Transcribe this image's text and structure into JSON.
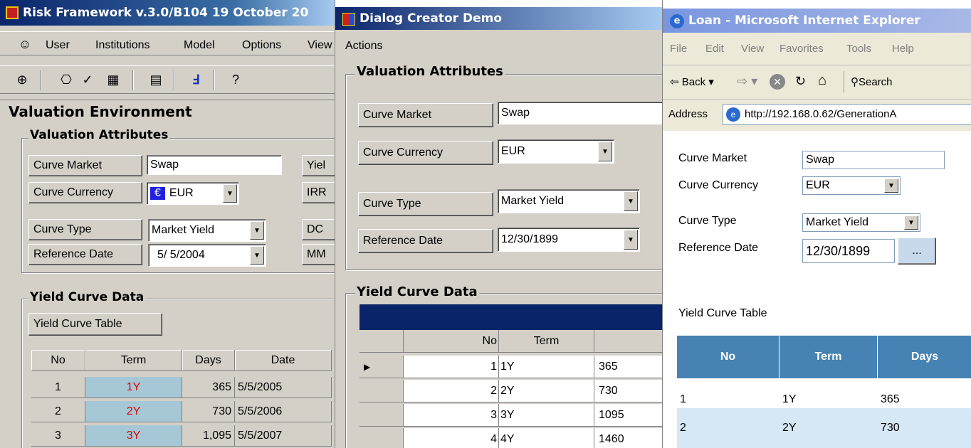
{
  "panel1": {
    "title": "Risk Framework v.3.0/B104 19 October 20",
    "menu": [
      "User",
      "Institutions",
      "Model",
      "Options",
      "View"
    ],
    "section_title": "Valuation Environment",
    "valuation_group": "Valuation Attributes",
    "curve_market_btn": "Curve Market",
    "curve_market_val": "Swap",
    "curve_currency_btn": "Curve Currency",
    "currency_symbol": "€",
    "curve_currency_val": "EUR",
    "curve_type_btn": "Curve Type",
    "curve_type_val": "Market Yield",
    "ref_date_btn": "Reference Date",
    "ref_date_val": "5/ 5/2004",
    "right_labels": [
      "Yiel",
      "IRR",
      "DC",
      "MM"
    ],
    "yield_group": "Yield Curve Data",
    "yield_table_btn": "Yield Curve Table",
    "grid_headers": [
      "No",
      "Term",
      "Days",
      "Date"
    ],
    "grid_rows": [
      {
        "no": "1",
        "term": "1Y",
        "days": "365",
        "date": "5/5/2005"
      },
      {
        "no": "2",
        "term": "2Y",
        "days": "730",
        "date": "5/5/2006"
      },
      {
        "no": "3",
        "term": "3Y",
        "days": "1,095",
        "date": "5/5/2007"
      }
    ]
  },
  "panel2": {
    "title": "Dialog Creator Demo",
    "menu": "Actions",
    "valuation_group": "Valuation Attributes",
    "curve_market_btn": "Curve Market",
    "curve_market_val": "Swap",
    "curve_currency_btn": "Curve Currency",
    "curve_currency_val": "EUR",
    "curve_type_btn": "Curve Type",
    "curve_type_val": "Market Yield",
    "ref_date_btn": "Reference Date",
    "ref_date_val": "12/30/1899",
    "yield_group": "Yield Curve Data",
    "grid_headers": [
      "No",
      "Term"
    ],
    "grid_rows": [
      {
        "no": "1",
        "term": "1Y",
        "days": "365"
      },
      {
        "no": "2",
        "term": "2Y",
        "days": "730"
      },
      {
        "no": "3",
        "term": "3Y",
        "days": "1095"
      },
      {
        "no": "4",
        "term": "4Y",
        "days": "1460"
      }
    ]
  },
  "panel3": {
    "title": "Loan - Microsoft Internet Explorer",
    "menu": [
      "File",
      "Edit",
      "View",
      "Favorites",
      "Tools",
      "Help"
    ],
    "back_label": "Back",
    "search_label": "Search",
    "address_label": "Address",
    "address_value": "http://192.168.0.62/GenerationA",
    "curve_market_label": "Curve Market",
    "curve_market_val": "Swap",
    "curve_currency_label": "Curve Currency",
    "curve_currency_val": "EUR",
    "curve_type_label": "Curve Type",
    "curve_type_val": "Market Yield",
    "ref_date_label": "Reference Date",
    "ref_date_val": "12/30/1899",
    "ellipsis_btn": "...",
    "yield_table_label": "Yield Curve Table",
    "table_headers": [
      "No",
      "Term",
      "Days"
    ],
    "table_rows": [
      {
        "no": "1",
        "term": "1Y",
        "days": "365"
      },
      {
        "no": "2",
        "term": "2Y",
        "days": "730"
      }
    ]
  },
  "colors": {
    "win_face": "#d4d0c8",
    "term_red": "#e00000",
    "grid_blue": "#a6c8d6",
    "ie_header": "#4682b4",
    "ie_row_alt": "#d6e8f5"
  }
}
